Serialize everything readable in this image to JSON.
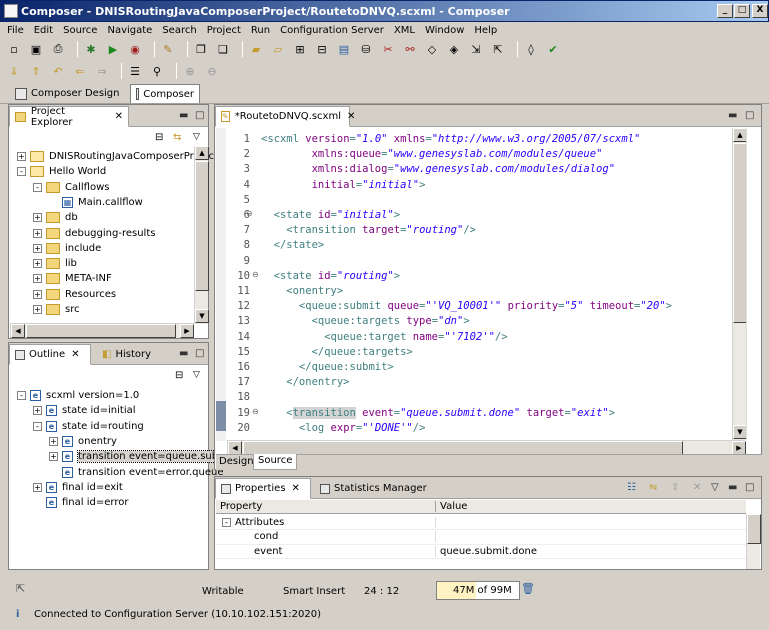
{
  "window": {
    "title": "Composer - DNISRoutingJavaComposerProject/RoutetoDNVQ.scxml - Composer",
    "min": "_",
    "max": "□",
    "close": "X"
  },
  "menu": [
    "File",
    "Edit",
    "Source",
    "Navigate",
    "Search",
    "Project",
    "Run",
    "Configuration Server",
    "XML",
    "Window",
    "Help"
  ],
  "perspectives": {
    "design": "Composer Design",
    "composer": "Composer"
  },
  "project_explorer": {
    "tab": "Project Explorer",
    "items": [
      {
        "label": "DNISRoutingJavaComposerProjec",
        "depth": 0,
        "kind": "project",
        "exp": "+"
      },
      {
        "label": "Hello World",
        "depth": 0,
        "kind": "project",
        "exp": "-"
      },
      {
        "label": "Callflows",
        "depth": 1,
        "kind": "folder",
        "exp": "-"
      },
      {
        "label": "Main.callflow",
        "depth": 2,
        "kind": "file",
        "exp": ""
      },
      {
        "label": "db",
        "depth": 1,
        "kind": "folder",
        "exp": "+"
      },
      {
        "label": "debugging-results",
        "depth": 1,
        "kind": "folder",
        "exp": "+"
      },
      {
        "label": "include",
        "depth": 1,
        "kind": "folder",
        "exp": "+"
      },
      {
        "label": "lib",
        "depth": 1,
        "kind": "folder",
        "exp": "+"
      },
      {
        "label": "META-INF",
        "depth": 1,
        "kind": "folder",
        "exp": "+"
      },
      {
        "label": "Resources",
        "depth": 1,
        "kind": "folder",
        "exp": "+"
      },
      {
        "label": "src",
        "depth": 1,
        "kind": "folder",
        "exp": "+"
      }
    ]
  },
  "outline": {
    "tab": "Outline",
    "history_tab": "History",
    "items": [
      {
        "label": "scxml version=1.0",
        "depth": 0,
        "exp": "-"
      },
      {
        "label": "state id=initial",
        "depth": 1,
        "exp": "+"
      },
      {
        "label": "state id=routing",
        "depth": 1,
        "exp": "-"
      },
      {
        "label": "onentry",
        "depth": 2,
        "exp": "+"
      },
      {
        "label": "transition event=queue.submi",
        "depth": 2,
        "exp": "+",
        "selected": true
      },
      {
        "label": "transition event=error.queue",
        "depth": 2,
        "exp": ""
      },
      {
        "label": "final id=exit",
        "depth": 1,
        "exp": "+"
      },
      {
        "label": "final id=error",
        "depth": 1,
        "exp": ""
      }
    ]
  },
  "editor": {
    "tab": "*RoutetoDNVQ.scxml",
    "bottom_tabs": {
      "design": "Design",
      "source": "Source"
    },
    "lines": [
      {
        "n": "1",
        "segs": [
          [
            "tag",
            "<scxml "
          ],
          [
            "att",
            "version"
          ],
          [
            "tag",
            "="
          ],
          [
            "val",
            "\"1.0\""
          ],
          [
            "tag",
            " "
          ],
          [
            "att",
            "xmlns"
          ],
          [
            "tag",
            "="
          ],
          [
            "val",
            "\"http://www.w3.org/2005/07/scxml\""
          ]
        ]
      },
      {
        "n": "2",
        "segs": [
          [
            "tag",
            "        "
          ],
          [
            "att",
            "xmlns:queue"
          ],
          [
            "tag",
            "="
          ],
          [
            "val",
            "\"www.genesyslab.com/modules/queue\""
          ]
        ]
      },
      {
        "n": "3",
        "segs": [
          [
            "tag",
            "        "
          ],
          [
            "att",
            "xmlns:dialog"
          ],
          [
            "tag",
            "="
          ],
          [
            "val",
            "\"www.genesyslab.com/modules/dialog\""
          ]
        ]
      },
      {
        "n": "4",
        "segs": [
          [
            "tag",
            "        "
          ],
          [
            "att",
            "initial"
          ],
          [
            "tag",
            "="
          ],
          [
            "val",
            "\"initial\""
          ],
          [
            "tag",
            ">"
          ]
        ]
      },
      {
        "n": "5",
        "segs": []
      },
      {
        "n": "6",
        "segs": [
          [
            "tag",
            "  <state "
          ],
          [
            "att",
            "id"
          ],
          [
            "tag",
            "="
          ],
          [
            "val",
            "\"initial\""
          ],
          [
            "tag",
            ">"
          ]
        ]
      },
      {
        "n": "7",
        "segs": [
          [
            "tag",
            "    <transition "
          ],
          [
            "att",
            "target"
          ],
          [
            "tag",
            "="
          ],
          [
            "val",
            "\"routing\""
          ],
          [
            "tag",
            "/>"
          ]
        ]
      },
      {
        "n": "8",
        "segs": [
          [
            "tag",
            "  </state>"
          ]
        ]
      },
      {
        "n": "9",
        "segs": []
      },
      {
        "n": "10",
        "segs": [
          [
            "tag",
            "  <state "
          ],
          [
            "att",
            "id"
          ],
          [
            "tag",
            "="
          ],
          [
            "val",
            "\"routing\""
          ],
          [
            "tag",
            ">"
          ]
        ]
      },
      {
        "n": "11",
        "segs": [
          [
            "tag",
            "    <onentry>"
          ]
        ]
      },
      {
        "n": "12",
        "segs": [
          [
            "tag",
            "      <queue:submit "
          ],
          [
            "att",
            "queue"
          ],
          [
            "tag",
            "="
          ],
          [
            "val",
            "\"'VQ_10001'\""
          ],
          [
            "tag",
            " "
          ],
          [
            "att",
            "priority"
          ],
          [
            "tag",
            "="
          ],
          [
            "val",
            "\"5\""
          ],
          [
            "tag",
            " "
          ],
          [
            "att",
            "timeout"
          ],
          [
            "tag",
            "="
          ],
          [
            "val",
            "\"20\""
          ],
          [
            "tag",
            ">"
          ]
        ]
      },
      {
        "n": "13",
        "segs": [
          [
            "tag",
            "        <queue:targets "
          ],
          [
            "att",
            "type"
          ],
          [
            "tag",
            "="
          ],
          [
            "val",
            "\"dn\""
          ],
          [
            "tag",
            ">"
          ]
        ]
      },
      {
        "n": "14",
        "segs": [
          [
            "tag",
            "          <queue:target "
          ],
          [
            "att",
            "name"
          ],
          [
            "tag",
            "="
          ],
          [
            "val",
            "\"'7102'\""
          ],
          [
            "tag",
            "/>"
          ]
        ]
      },
      {
        "n": "15",
        "segs": [
          [
            "tag",
            "        </queue:targets>"
          ]
        ]
      },
      {
        "n": "16",
        "segs": [
          [
            "tag",
            "      </queue:submit>"
          ]
        ]
      },
      {
        "n": "17",
        "segs": [
          [
            "tag",
            "    </onentry>"
          ]
        ]
      },
      {
        "n": "18",
        "segs": []
      },
      {
        "n": "19",
        "segs": [
          [
            "tag",
            "    <"
          ],
          [
            "tag",
            "transition"
          ],
          [
            "tag",
            " "
          ],
          [
            "att",
            "event"
          ],
          [
            "tag",
            "="
          ],
          [
            "val",
            "\"queue.submit.done\""
          ],
          [
            "tag",
            " "
          ],
          [
            "att",
            "target"
          ],
          [
            "tag",
            "="
          ],
          [
            "val",
            "\"exit\""
          ],
          [
            "tag",
            ">"
          ]
        ]
      },
      {
        "n": "20",
        "segs": [
          [
            "tag",
            "      <log "
          ],
          [
            "att",
            "expr"
          ],
          [
            "tag",
            "="
          ],
          [
            "val",
            "\"'DONE'\""
          ],
          [
            "tag",
            "/>"
          ]
        ]
      }
    ]
  },
  "properties": {
    "tab": "Properties",
    "stats_tab": "Statistics Manager",
    "col_property": "Property",
    "col_value": "Value",
    "rows": [
      {
        "property": "Attributes",
        "value": "",
        "group": true
      },
      {
        "property": "cond",
        "value": ""
      },
      {
        "property": "event",
        "value": "queue.submit.done"
      }
    ]
  },
  "status": {
    "writable": "Writable",
    "insert": "Smart Insert",
    "position": "24 : 12",
    "memory": "47M of 99M",
    "memory_fraction": 0.47,
    "connection": "Connected to Configuration Server (10.10.102.151:2020)"
  },
  "colors": {
    "title_start": "#0a246a",
    "title_end": "#a6caf0",
    "tag": "#3f7f7f",
    "attr": "#7f007f",
    "value": "#2a00ff"
  }
}
